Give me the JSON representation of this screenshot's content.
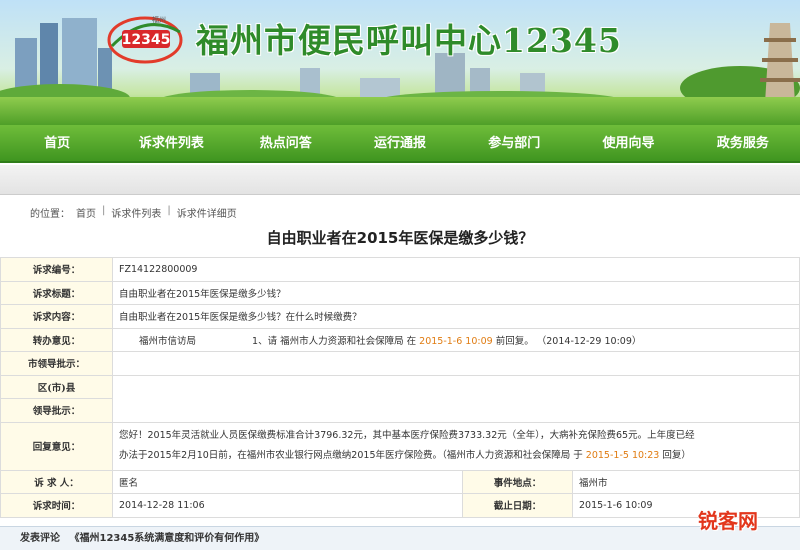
{
  "header": {
    "logo_text": "12345",
    "logo_sub": "福州",
    "title": "福州市便民呼叫中心12345"
  },
  "nav": [
    {
      "label": "首页"
    },
    {
      "label": "诉求件列表"
    },
    {
      "label": "热点问答"
    },
    {
      "label": "运行通报"
    },
    {
      "label": "参与部门"
    },
    {
      "label": "使用向导"
    },
    {
      "label": "政务服务"
    }
  ],
  "breadcrumb": {
    "prefix": "的位置：",
    "items": [
      "首页",
      "诉求件列表",
      "诉求件详细页"
    ],
    "separator": "|"
  },
  "page_title": "自由职业者在2015年医保是缴多少钱？",
  "detail": {
    "id_label": "诉求编号：",
    "id_value": "FZ14122800009",
    "title_label": "诉求标题：",
    "title_value": "自由职业者在2015年医保是缴多少钱？",
    "content_label": "诉求内容：",
    "content_value": "自由职业者在2015年医保是缴多少钱？在什么时候缴费？",
    "transfer_label": "转办意见：",
    "transfer_dept": "福州市信访局",
    "transfer_text_1": "1、请 福州市人力资源和社会保障局 在",
    "transfer_deadline": "2015-1-6 10:09",
    "transfer_text_2": "前回复。",
    "transfer_time": "（2014-12-29 10:09）",
    "city_leader_label": "市领导批示：",
    "district_label": "区(市)县",
    "district_leader_label": "领导批示：",
    "reply_label": "回复意见：",
    "reply_line_1": "您好！2015年灵活就业人员医保缴费标准合计3796.32元，其中基本医疗保险费3733.32元（全年），大病补充保险费65元。上年度已经",
    "reply_line_2_a": "办法于2015年2月10日前，在福州市农业银行网点缴纳2015年医疗保险费。（福州市人力资源和社会保障局 于",
    "reply_line_2_date": "2015-1-5 10:23",
    "reply_line_2_b": "回复）",
    "requester_label": "诉 求 人：",
    "requester_value": "匿名",
    "location_label": "事件地点：",
    "location_value": "福州市",
    "time_label": "诉求时间：",
    "time_value": "2014-12-28 11:06",
    "deadline_label": "截止日期：",
    "deadline_value": "2015-1-6 10:09"
  },
  "footer": {
    "label": "发表评论",
    "link": "《福州12345系统满意度和评价有何作用》"
  },
  "watermark": "锐客网",
  "colors": {
    "nav_green": "#4fa62a",
    "label_red": "#c8262b",
    "date_orange": "#e07c12"
  }
}
